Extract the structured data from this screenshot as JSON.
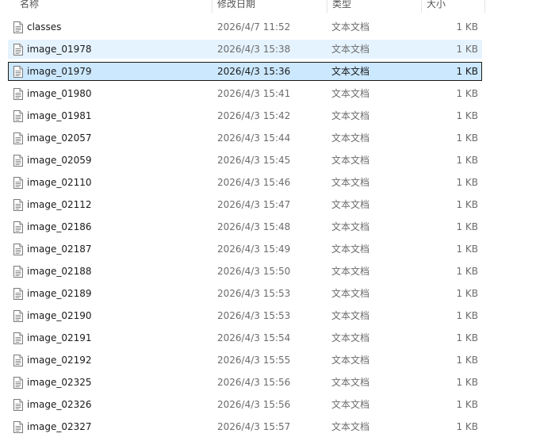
{
  "columns": {
    "name": "名称",
    "date": "修改日期",
    "type": "类型",
    "size": "大小"
  },
  "files": [
    {
      "name": "classes",
      "date": "2026/4/7 11:52",
      "type": "文本文档",
      "size": "1 KB",
      "state": "normal"
    },
    {
      "name": "image_01978",
      "date": "2026/4/3 15:38",
      "type": "文本文档",
      "size": "1 KB",
      "state": "hover"
    },
    {
      "name": "image_01979",
      "date": "2026/4/3 15:36",
      "type": "文本文档",
      "size": "1 KB",
      "state": "selected"
    },
    {
      "name": "image_01980",
      "date": "2026/4/3 15:41",
      "type": "文本文档",
      "size": "1 KB",
      "state": "normal"
    },
    {
      "name": "image_01981",
      "date": "2026/4/3 15:42",
      "type": "文本文档",
      "size": "1 KB",
      "state": "normal"
    },
    {
      "name": "image_02057",
      "date": "2026/4/3 15:44",
      "type": "文本文档",
      "size": "1 KB",
      "state": "normal"
    },
    {
      "name": "image_02059",
      "date": "2026/4/3 15:45",
      "type": "文本文档",
      "size": "1 KB",
      "state": "normal"
    },
    {
      "name": "image_02110",
      "date": "2026/4/3 15:46",
      "type": "文本文档",
      "size": "1 KB",
      "state": "normal"
    },
    {
      "name": "image_02112",
      "date": "2026/4/3 15:47",
      "type": "文本文档",
      "size": "1 KB",
      "state": "normal"
    },
    {
      "name": "image_02186",
      "date": "2026/4/3 15:48",
      "type": "文本文档",
      "size": "1 KB",
      "state": "normal"
    },
    {
      "name": "image_02187",
      "date": "2026/4/3 15:49",
      "type": "文本文档",
      "size": "1 KB",
      "state": "normal"
    },
    {
      "name": "image_02188",
      "date": "2026/4/3 15:50",
      "type": "文本文档",
      "size": "1 KB",
      "state": "normal"
    },
    {
      "name": "image_02189",
      "date": "2026/4/3 15:53",
      "type": "文本文档",
      "size": "1 KB",
      "state": "normal"
    },
    {
      "name": "image_02190",
      "date": "2026/4/3 15:53",
      "type": "文本文档",
      "size": "1 KB",
      "state": "normal"
    },
    {
      "name": "image_02191",
      "date": "2026/4/3 15:54",
      "type": "文本文档",
      "size": "1 KB",
      "state": "normal"
    },
    {
      "name": "image_02192",
      "date": "2026/4/3 15:55",
      "type": "文本文档",
      "size": "1 KB",
      "state": "normal"
    },
    {
      "name": "image_02325",
      "date": "2026/4/3 15:56",
      "type": "文本文档",
      "size": "1 KB",
      "state": "normal"
    },
    {
      "name": "image_02326",
      "date": "2026/4/3 15:56",
      "type": "文本文档",
      "size": "1 KB",
      "state": "normal"
    },
    {
      "name": "image_02327",
      "date": "2026/4/3 15:57",
      "type": "文本文档",
      "size": "1 KB",
      "state": "normal"
    }
  ],
  "icons": {
    "file": "text-document-icon"
  },
  "colors": {
    "hover_bg": "#e5f3ff",
    "selected_bg": "#cce8ff",
    "selected_border": "#1a1a1a",
    "secondary_text": "#6d6d6d"
  }
}
